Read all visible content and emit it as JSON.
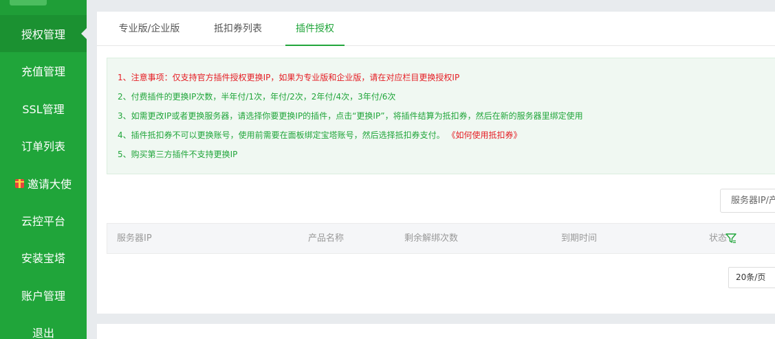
{
  "sidebar": {
    "items": [
      {
        "label": "授权管理"
      },
      {
        "label": "充值管理"
      },
      {
        "label": "SSL管理"
      },
      {
        "label": "订单列表"
      },
      {
        "label": "邀请大使"
      },
      {
        "label": "云控平台"
      },
      {
        "label": "安装宝塔"
      },
      {
        "label": "账户管理"
      },
      {
        "label": "退出"
      }
    ],
    "active_index": 0
  },
  "tabs": [
    {
      "label": "专业版/企业版"
    },
    {
      "label": "抵扣券列表"
    },
    {
      "label": "插件授权"
    }
  ],
  "active_tab": 2,
  "notice": {
    "line1": "1、注意事项：仅支持官方插件授权更换IP，如果为专业版和企业版，请在对应栏目更换授权IP",
    "line2": "2、付费插件的更换IP次数，半年付/1次，年付/2次，2年付/4次，3年付/6次",
    "line3": "3、如需更改IP或者更换服务器，请选择你要更换IP的插件，点击“更换IP”，将插件结算为抵扣券，然后在新的服务器里绑定使用",
    "line4": "4、插件抵扣券不可以更换账号，使用前需要在面板绑定宝塔账号，然后选择抵扣券支付。",
    "line4_link": "《如何使用抵扣券》",
    "line5": "5、购买第三方插件不支持更换IP"
  },
  "search": {
    "placeholder": "服务器IP/产"
  },
  "table": {
    "columns": [
      "服务器IP",
      "产品名称",
      "剩余解绑次数",
      "到期时间",
      "状态"
    ]
  },
  "pagination": {
    "page_size": "20条/页"
  },
  "colors": {
    "brand_green": "#20a53a",
    "warning_red": "#e51c23"
  }
}
